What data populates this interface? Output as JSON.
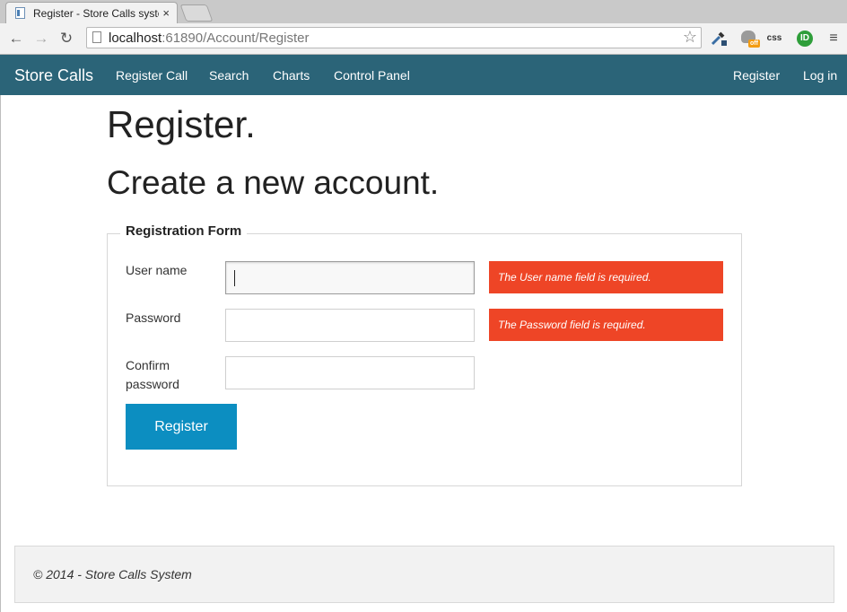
{
  "browser": {
    "tab_title": "Register - Store Calls syste",
    "tab_close": "×",
    "url_host": "localhost",
    "url_path": ":61890/Account/Register",
    "back": "←",
    "forward": "→",
    "reload": "↻",
    "star": "☆",
    "ext_css": "css",
    "ext_id": "ID",
    "ext_off": "off",
    "menu": "≡"
  },
  "navbar": {
    "brand": "Store Calls",
    "links": [
      "Register Call",
      "Search",
      "Charts",
      "Control Panel"
    ],
    "right_links": [
      "Register",
      "Log in"
    ],
    "color": "#2b6478"
  },
  "page": {
    "title": "Register.",
    "subtitle": "Create a new account."
  },
  "form": {
    "legend": "Registration Form",
    "fields": [
      {
        "label": "User name",
        "value": "",
        "error": "The User name field is required."
      },
      {
        "label": "Password",
        "value": "",
        "error": "The Password field is required."
      },
      {
        "label_line1": "Confirm",
        "label_line2": "password",
        "value": ""
      }
    ],
    "submit": "Register",
    "error_color": "#ee4526",
    "button_color": "#0c8ec1"
  },
  "footer": {
    "text": "© 2014 - Store Calls System"
  }
}
